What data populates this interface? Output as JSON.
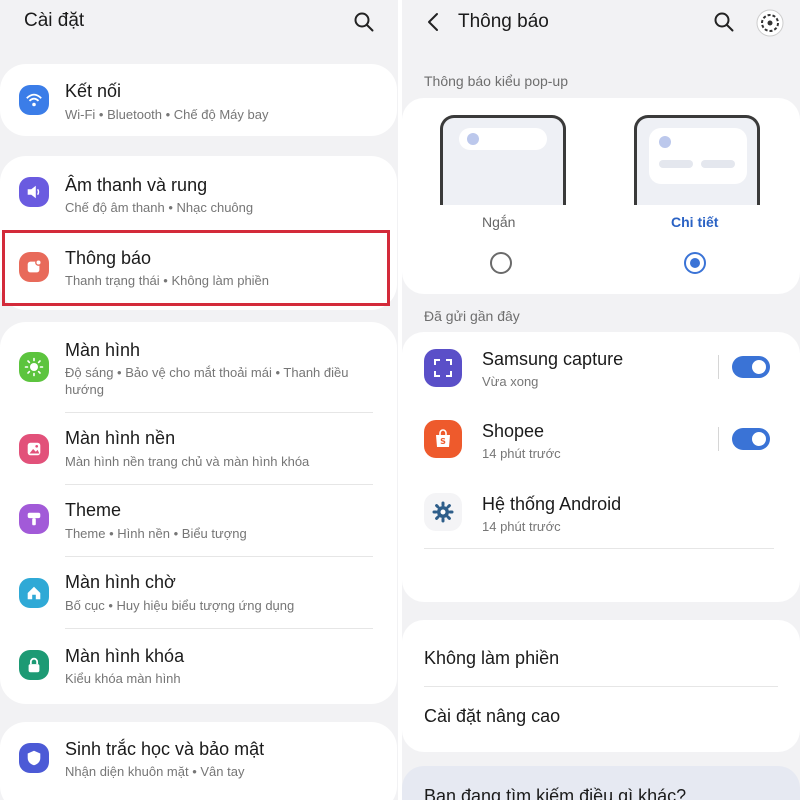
{
  "left": {
    "title": "Cài đặt",
    "items": [
      {
        "label": "Kết nối",
        "sub": "Wi-Fi  •  Bluetooth  •  Chế độ Máy bay",
        "icon": "wifi-icon",
        "color": "#3b7de8"
      },
      {
        "label": "Âm thanh và rung",
        "sub": "Chế độ âm thanh  •  Nhạc chuông",
        "icon": "speaker-icon",
        "color": "#6a5be0"
      },
      {
        "label": "Thông báo",
        "sub": "Thanh trạng thái  •  Không làm phiền",
        "icon": "notification-icon",
        "color": "#e86a5a"
      },
      {
        "label": "Màn hình",
        "sub": "Độ sáng  •  Bảo vệ cho mắt thoải mái  •  Thanh điều hướng",
        "icon": "sun-icon",
        "color": "#5cc43e"
      },
      {
        "label": "Màn hình nền",
        "sub": "Màn hình nền trang chủ và màn hình khóa",
        "icon": "image-icon",
        "color": "#e2517a"
      },
      {
        "label": "Theme",
        "sub": "Theme  •  Hình nền  •  Biểu tượng",
        "icon": "theme-brush-icon",
        "color": "#a25ad8"
      },
      {
        "label": "Màn hình chờ",
        "sub": "Bố cục  •  Huy hiệu biểu tượng ứng dụng",
        "icon": "home-icon",
        "color": "#2fa9d6"
      },
      {
        "label": "Màn hình khóa",
        "sub": "Kiểu khóa màn hình",
        "icon": "lock-icon",
        "color": "#1d9a74"
      },
      {
        "label": "Sinh trắc học và bảo mật",
        "sub": "Nhận diện khuôn mặt  •  Vân tay",
        "icon": "shield-icon",
        "color": "#4c5ad6"
      }
    ]
  },
  "right": {
    "title": "Thông báo",
    "popup_section": "Thông báo kiểu pop-up",
    "popup_options": [
      {
        "label": "Ngắn",
        "selected": false
      },
      {
        "label": "Chi tiết",
        "selected": true
      }
    ],
    "recent_section": "Đã gửi gần đây",
    "apps": [
      {
        "name": "Samsung capture",
        "time": "Vừa xong",
        "icon": "capture-icon",
        "color": "#5a4fc8",
        "toggle": true
      },
      {
        "name": "Shopee",
        "time": "14 phút trước",
        "icon": "shopee-icon",
        "color": "#ee5a2c",
        "toggle": true
      },
      {
        "name": "Hệ thống Android",
        "time": "14 phút trước",
        "icon": "android-gear-icon",
        "color": "#2e5e8a",
        "toggle": false
      }
    ],
    "options": [
      "Không làm phiền",
      "Cài đặt nâng cao"
    ],
    "bottom_prompt": "Bạn đang tìm kiếm điều gì khác?"
  },
  "colors": {
    "accent": "#3a73d6",
    "highlight": "#d32a3a",
    "background": "#f2f2f4"
  }
}
